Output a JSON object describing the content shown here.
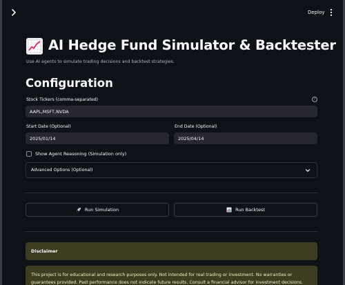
{
  "header": {
    "deploy_label": "Deploy"
  },
  "page": {
    "title_emoji_icon": "chart-increasing-emoji",
    "title": "AI Hedge Fund Simulator & Backtester",
    "subtitle": "Use AI agents to simulate trading decisions and backtest strategies.",
    "section_heading": "Configuration"
  },
  "form": {
    "tickers_label": "Stock Tickers (comma-separated)",
    "tickers_value": "AAPL,MSFT,NVDA",
    "start_date_label": "Start Date (Optional)",
    "start_date_value": "2025/01/14",
    "end_date_label": "End Date (Optional)",
    "end_date_value": "2025/04/14",
    "show_reasoning_label": "Show Agent Reasoning (Simulation only)",
    "show_reasoning_checked": false,
    "advanced_label": "Advanced Options (Optional)"
  },
  "actions": {
    "run_simulation_label": "Run Simulation",
    "run_simulation_icon": "rocket-emoji",
    "run_backtest_label": "Run Backtest",
    "run_backtest_icon": "bar-chart-emoji"
  },
  "disclaimer": {
    "heading": "Disclaimer",
    "body": "This project is for educational and research purposes only. Not intended for real trading or investment. No warranties or guarantees provided. Past performance does not indicate future results. Consult a financial advisor for investment decisions."
  },
  "colors": {
    "background": "#0e1117",
    "input_bg": "#262730",
    "warning_bg": "#3e3d22",
    "warning_text": "#f6f2c6"
  }
}
